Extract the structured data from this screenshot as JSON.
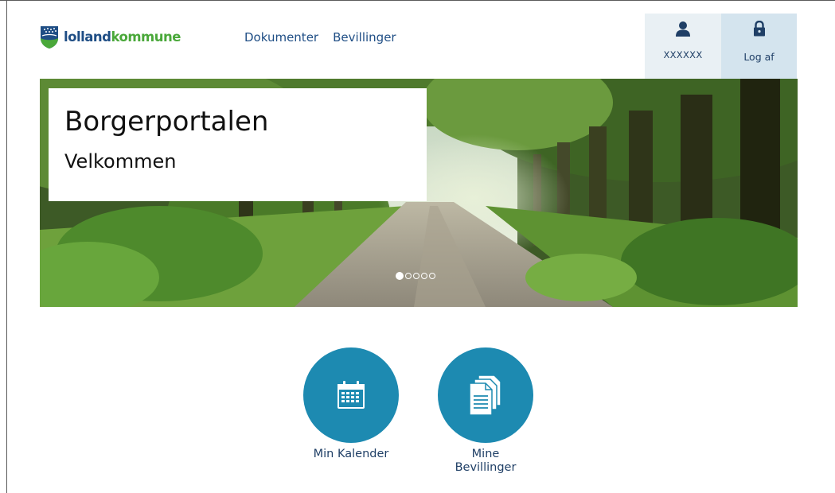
{
  "brand": {
    "name_part1": "lolland",
    "name_part2": "kommune",
    "color_dark": "#1f4e85",
    "color_green": "#4aa83a",
    "logo_icon": "lolland-crest-icon"
  },
  "nav": {
    "items": [
      {
        "label": "Dokumenter"
      },
      {
        "label": "Bevillinger"
      }
    ]
  },
  "account": {
    "user_icon": "user-icon",
    "username": "XXXXXX",
    "logout_icon": "lock-icon",
    "logout_label": "Log af"
  },
  "hero": {
    "title": "Borgerportalen",
    "subtitle": "Velkommen",
    "slides_total": 5,
    "active_slide": 1
  },
  "tiles": [
    {
      "label": "Min Kalender",
      "icon": "calendar-icon",
      "color": "#1d8ab1"
    },
    {
      "label": "Mine Bevillinger",
      "icon": "documents-icon",
      "color": "#1d8ab1"
    }
  ]
}
